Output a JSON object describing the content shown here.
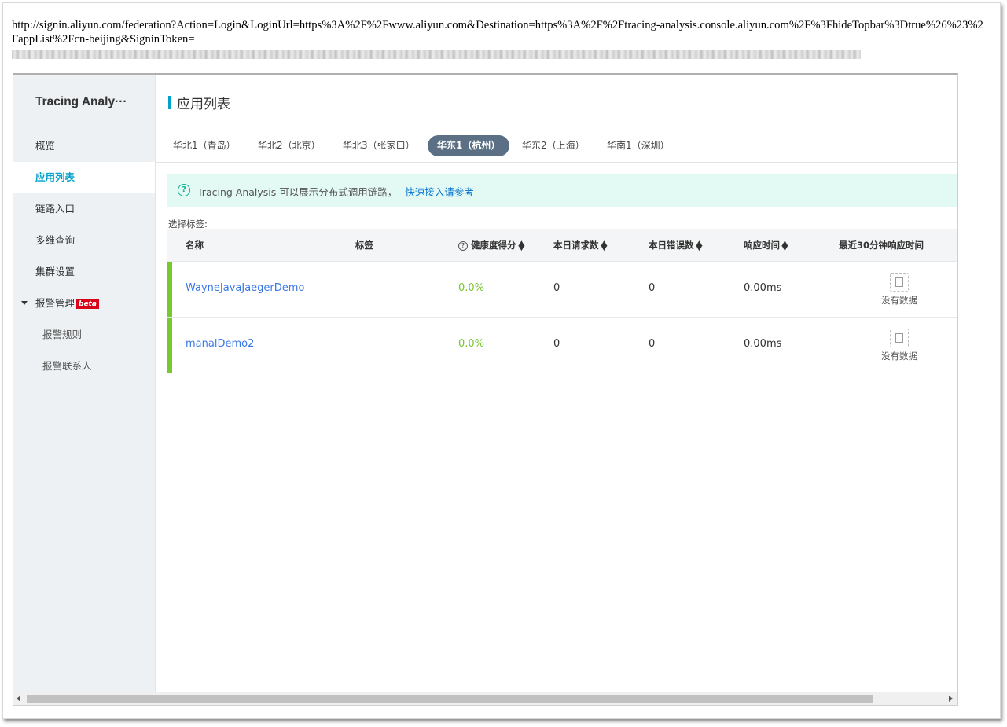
{
  "address_bar": {
    "url": "http://signin.aliyun.com/federation?Action=Login&LoginUrl=https%3A%2F%2Fwww.aliyun.com&Destination=https%3A%2F%2Ftracing-analysis.console.aliyun.com%2F%3FhideTopbar%3Dtrue%26%23%2FappList%2Fcn-beijing&SigninToken="
  },
  "sidebar": {
    "brand": "Tracing Analy···",
    "items": [
      {
        "label": "概览"
      },
      {
        "label": "应用列表",
        "active": true
      },
      {
        "label": "链路入口"
      },
      {
        "label": "多维查询"
      },
      {
        "label": "集群设置"
      },
      {
        "label": "报警管理",
        "badge": "beta",
        "expanded": true
      },
      {
        "label": "报警规则",
        "sub": true
      },
      {
        "label": "报警联系人",
        "sub": true
      }
    ]
  },
  "page": {
    "title": "应用列表",
    "region_tabs": [
      {
        "label": "华北1（青岛）"
      },
      {
        "label": "华北2（北京）"
      },
      {
        "label": "华北3（张家口）"
      },
      {
        "label": "华东1（杭州）",
        "active": true
      },
      {
        "label": "华东2（上海）"
      },
      {
        "label": "华南1（深圳）"
      }
    ],
    "notice": {
      "text": "Tracing Analysis 可以展示分布式调用链路，",
      "link": "快速接入请参考",
      "icon": "help-circle-icon"
    },
    "tag_select_label": "选择标签:",
    "table": {
      "columns": [
        "名称",
        "标签",
        "健康度得分",
        "本日请求数",
        "本日错误数",
        "响应时间",
        "最近30分钟响应时间"
      ],
      "rows": [
        {
          "name": "WayneJavaJaegerDemo",
          "tags": "",
          "health": "0.0%",
          "requests": "0",
          "errors": "0",
          "response_time": "0.00ms",
          "recent": "没有数据"
        },
        {
          "name": "manalDemo2",
          "tags": "",
          "health": "0.0%",
          "requests": "0",
          "errors": "0",
          "response_time": "0.00ms",
          "recent": "没有数据"
        }
      ]
    }
  },
  "colors": {
    "accent": "#00a2ca",
    "active_tab": "#5b7085",
    "health_bar": "#76c92e",
    "link": "#3b78e7",
    "notice_bg": "#e3f9f4"
  }
}
